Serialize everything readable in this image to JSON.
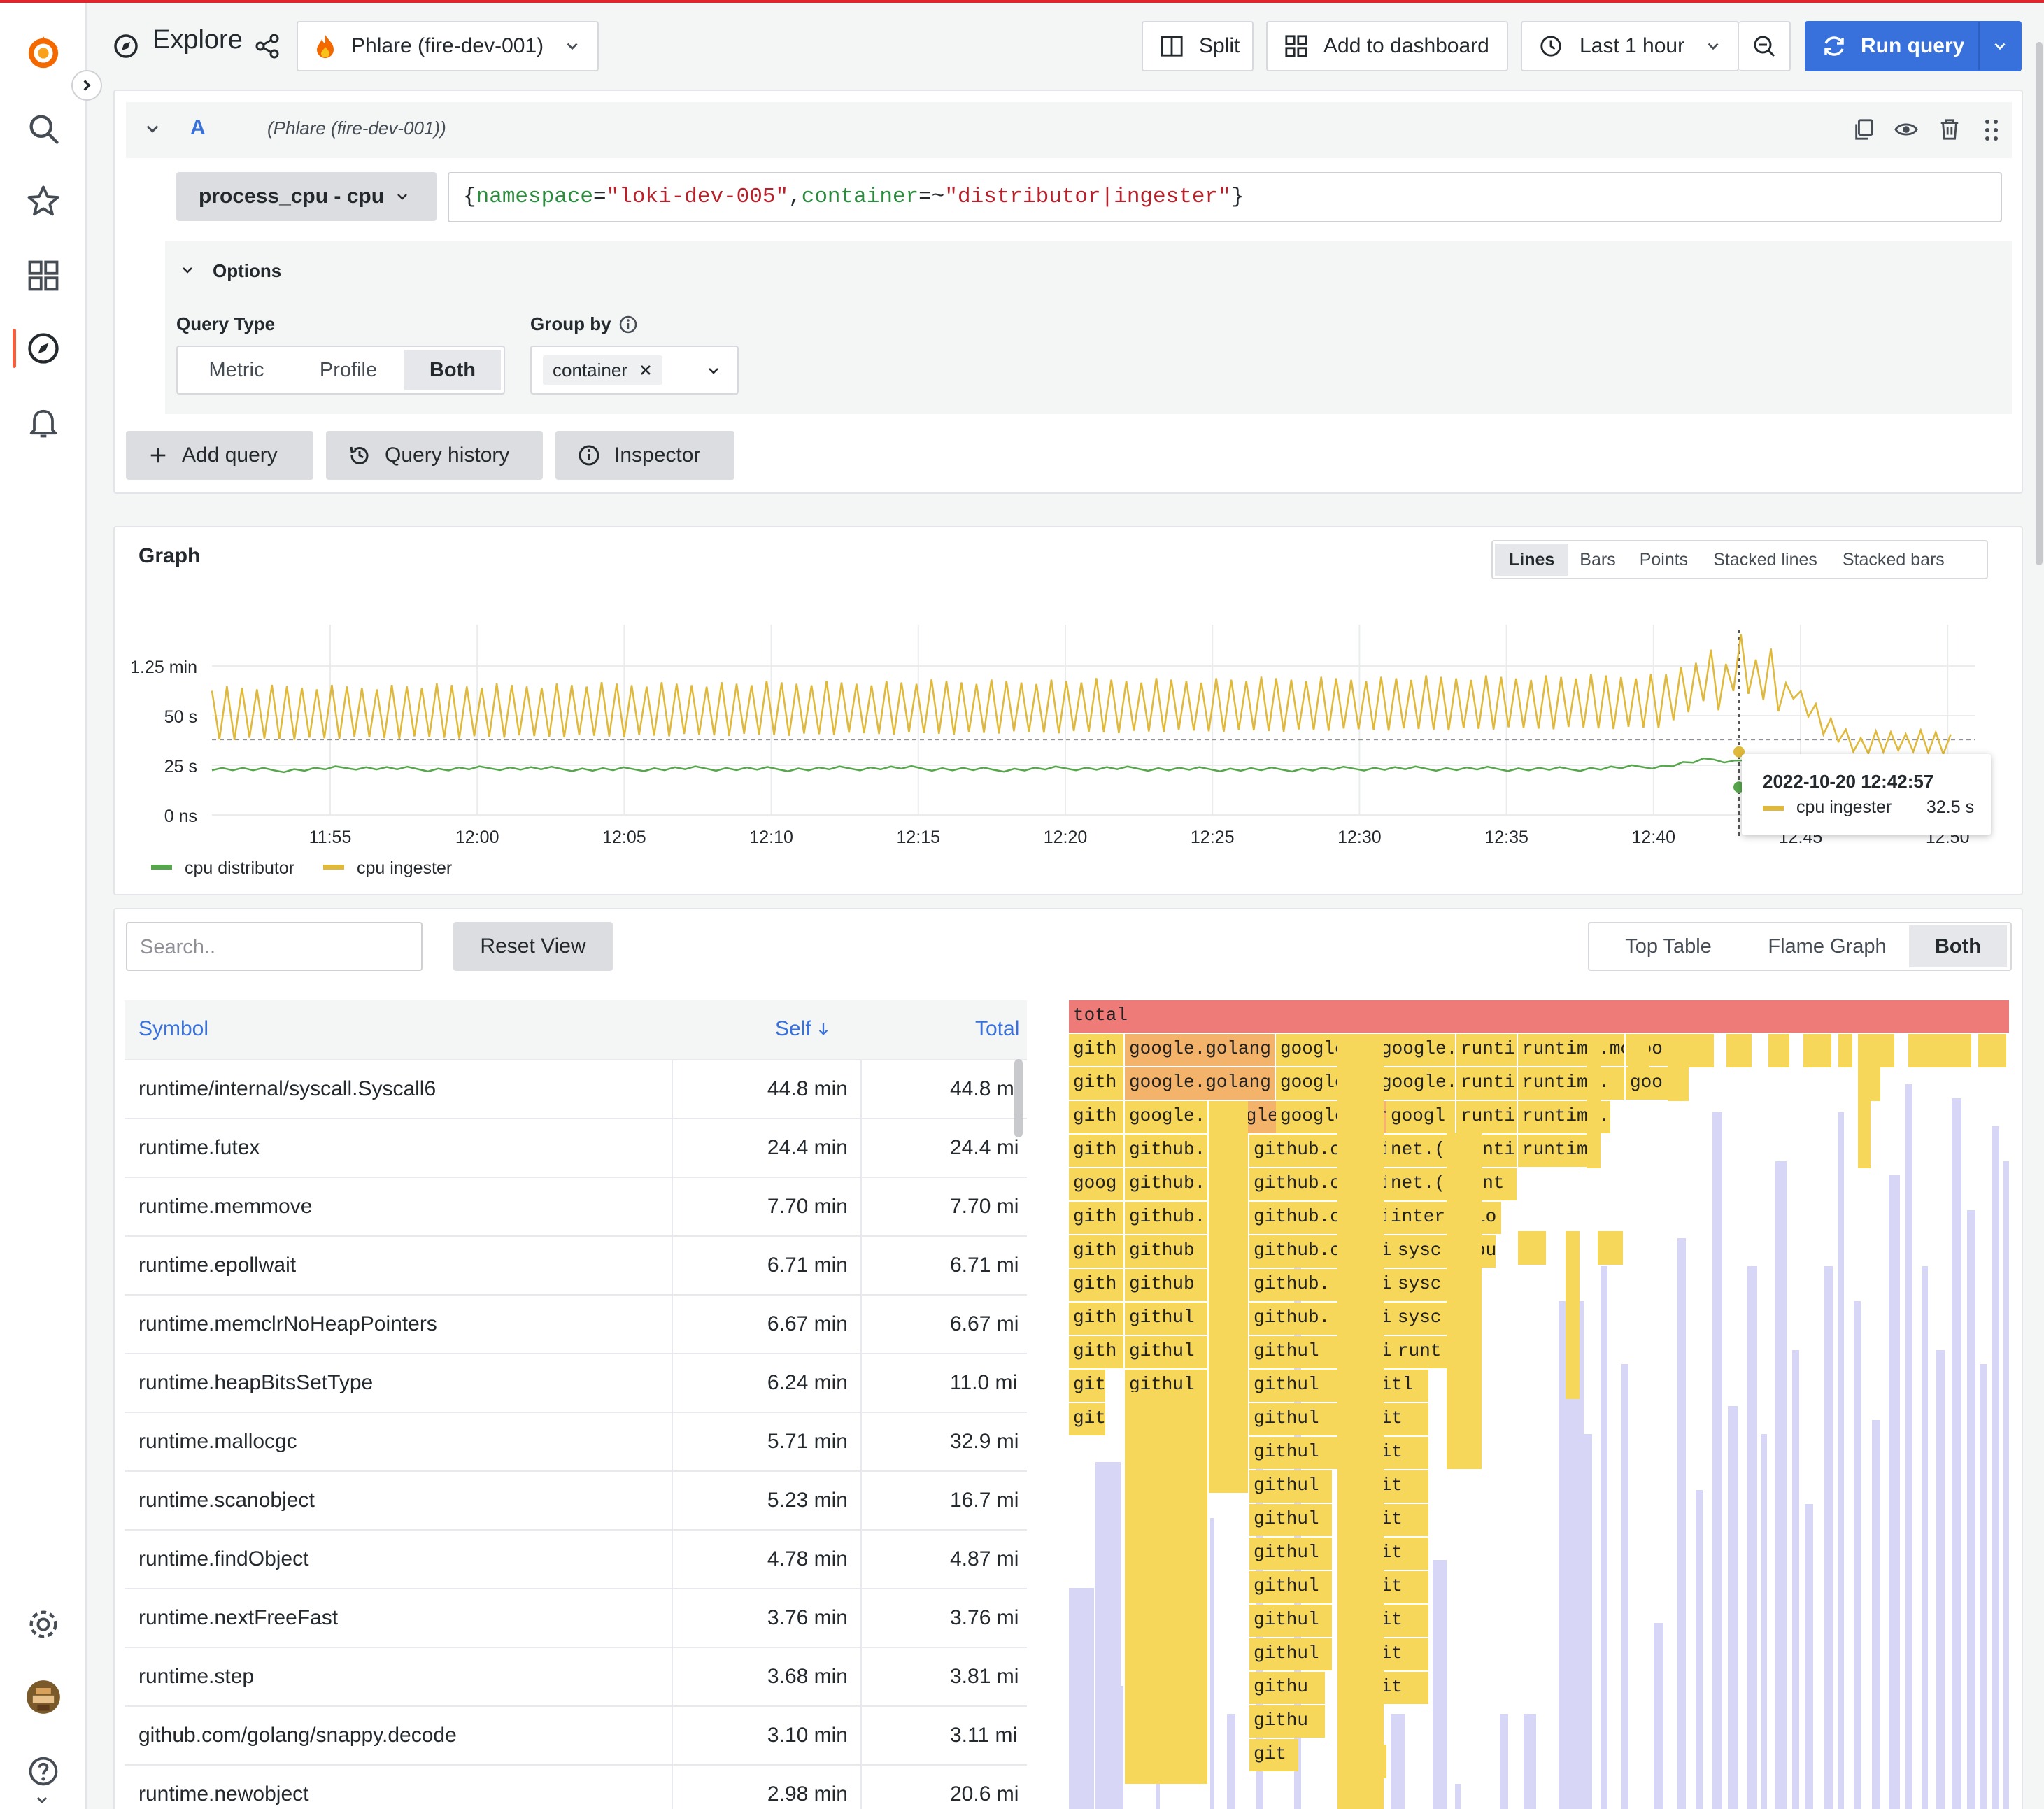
{
  "header": {
    "title": "Explore",
    "datasource": "Phlare (fire-dev-001)",
    "split_label": "Split",
    "add_to_dashboard_label": "Add to dashboard",
    "time_range": "Last 1 hour",
    "run_query_label": "Run query"
  },
  "query": {
    "ref_id": "A",
    "datasource_label": "(Phlare (fire-dev-001))",
    "profile_type": "process_cpu - cpu",
    "selector": {
      "open": "{",
      "key1": "namespace",
      "op1": "=",
      "val1": "\"loki-dev-005\"",
      "comma": ",",
      "key2": "container",
      "op2": "=~",
      "val2": "\"distributor|ingester\"",
      "close": "}"
    },
    "options_label": "Options",
    "query_type_label": "Query Type",
    "query_types": [
      "Metric",
      "Profile",
      "Both"
    ],
    "query_type_selected": "Both",
    "group_by_label": "Group by",
    "group_by_value": "container",
    "add_query_label": "Add query",
    "history_label": "Query history",
    "inspector_label": "Inspector"
  },
  "graph": {
    "title": "Graph",
    "styles": [
      "Lines",
      "Bars",
      "Points",
      "Stacked lines",
      "Stacked bars"
    ],
    "style_selected": "Lines"
  },
  "chart_data": {
    "type": "line",
    "x_ticks": [
      "11:55",
      "12:00",
      "12:05",
      "12:10",
      "12:15",
      "12:20",
      "12:25",
      "12:30",
      "12:35",
      "12:40",
      "12:45",
      "12:50"
    ],
    "y_ticks": [
      "1.25 min",
      "50 s",
      "25 s",
      "0 ns"
    ],
    "y_tick_values_s": [
      75,
      50,
      25,
      0
    ],
    "ylim_s": [
      0,
      92
    ],
    "x_start_min": 11.6,
    "x_end_min": 71.6,
    "threshold_s": 38,
    "grid": true,
    "legend_position": "bottom-left",
    "series": [
      {
        "name": "cpu distributor",
        "color": "#56a64b",
        "x_min": [
          11.6,
          13.8,
          16.5,
          19.1,
          21.5,
          25.0,
          28.0,
          31.2,
          34.8,
          38.1,
          41.0,
          44.5,
          47.9,
          51.0,
          54.5,
          57.8,
          61.0,
          62.6,
          63.4,
          64.0,
          64.5,
          65.0,
          65.8,
          67.0,
          68.0,
          69.3,
          70.1
        ],
        "values_s": [
          23.5,
          22.4,
          23.8,
          22.9,
          23.6,
          22.8,
          23.4,
          23.0,
          23.7,
          22.7,
          23.5,
          23.1,
          22.8,
          23.4,
          23.2,
          23.0,
          24.5,
          28.0,
          27.0,
          29.0,
          27.5,
          19.5,
          20.2,
          19.4,
          19.9,
          16.6,
          14.2
        ]
      },
      {
        "name": "cpu ingester",
        "color": "#e0b93a",
        "x_min": [
          11.6,
          61.0,
          62.6,
          63.0,
          63.6,
          64.1,
          64.6,
          65.0,
          65.4,
          66.4,
          67.6,
          68.4,
          70.8
        ],
        "values_s": [
          50.0,
          56.0,
          70.0,
          60.0,
          80.0,
          64.0,
          72.0,
          60.0,
          62.0,
          45.0,
          34.0,
          36.0,
          35.0
        ]
      }
    ],
    "tooltip": {
      "time": "2022-10-20 12:42:57",
      "series": "cpu ingester",
      "value": "32.5 s",
      "x_min": 68.4,
      "value_s": 32.5
    }
  },
  "profile": {
    "search_placeholder": "Search..",
    "reset_label": "Reset View",
    "view_modes": [
      "Top Table",
      "Flame Graph",
      "Both"
    ],
    "view_selected": "Both",
    "table": {
      "headers": [
        "Symbol",
        "Self",
        "Total"
      ],
      "rows": [
        {
          "symbol": "runtime/internal/syscall.Syscall6",
          "self": "44.8 min",
          "total": "44.8 mi"
        },
        {
          "symbol": "runtime.futex",
          "self": "24.4 min",
          "total": "24.4 mi"
        },
        {
          "symbol": "runtime.memmove",
          "self": "7.70 min",
          "total": "7.70 mi"
        },
        {
          "symbol": "runtime.epollwait",
          "self": "6.71 min",
          "total": "6.71 mi"
        },
        {
          "symbol": "runtime.memclrNoHeapPointers",
          "self": "6.67 min",
          "total": "6.67 mi"
        },
        {
          "symbol": "runtime.heapBitsSetType",
          "self": "6.24 min",
          "total": "11.0 mi"
        },
        {
          "symbol": "runtime.mallocgc",
          "self": "5.71 min",
          "total": "32.9 mi"
        },
        {
          "symbol": "runtime.scanobject",
          "self": "5.23 min",
          "total": "16.7 mi"
        },
        {
          "symbol": "runtime.findObject",
          "self": "4.78 min",
          "total": "4.87 mi"
        },
        {
          "symbol": "runtime.nextFreeFast",
          "self": "3.76 min",
          "total": "3.76 mi"
        },
        {
          "symbol": "runtime.step",
          "self": "3.68 min",
          "total": "3.81 mi"
        },
        {
          "symbol": "github.com/golang/snappy.decode",
          "self": "3.10 min",
          "total": "3.11 mi"
        },
        {
          "symbol": "runtime.newobject",
          "self": "2.98 min",
          "total": "20.6 mi"
        }
      ]
    },
    "flame": {
      "root": "total",
      "rows": [
        [
          "gith",
          "google.golang.org/grpc.(*Ser",
          "google.go",
          "google.",
          "runti",
          "runtime.mc",
          "goo"
        ],
        [
          "gith",
          "google.golang.org/grpc.(*Ser",
          "google.go",
          "google.",
          "runti",
          "runtime.",
          "goo"
        ],
        [
          "gith",
          "google.",
          "google.golang.org/grp",
          "google.go",
          "googl",
          "runti",
          "runtime."
        ],
        [
          "gith",
          "github.",
          "git",
          "github.com",
          "githu",
          "golan",
          "net.(",
          "runti",
          "runtim"
        ],
        [
          "goog",
          "github.",
          "git",
          "github.c",
          "gith",
          "gol",
          "net.(",
          "runt"
        ],
        [
          "gith",
          "github.",
          "git",
          "github.c",
          "gith",
          "io",
          "inter"
        ],
        [
          "gith",
          "github",
          "git",
          "github.c",
          "gith",
          "bu",
          "sysc"
        ],
        [
          "gith",
          "github",
          "github.",
          "gith",
          "sysc"
        ],
        [
          "gith",
          "githul",
          "github.",
          "gith",
          "sysc"
        ],
        [
          "gith",
          "githul",
          "githul",
          "gitl",
          "runt"
        ],
        [
          "git",
          "githul",
          "githul",
          "gitl"
        ],
        [
          "git",
          "githul",
          "githul",
          "git"
        ],
        [
          "githul",
          "githul",
          "git"
        ],
        [
          "githu",
          "githul",
          "git"
        ],
        [
          "githu",
          "githul",
          "git"
        ],
        [
          "githu",
          "githul",
          "git"
        ],
        [
          "githu",
          "githul",
          "git"
        ],
        [
          "githul",
          "git"
        ],
        [
          "githul",
          "git"
        ],
        [
          "githu",
          "git"
        ],
        [
          "githu"
        ],
        [
          "git"
        ]
      ]
    }
  },
  "colors": {
    "accent": "#3871dc",
    "distributor": "#56a64b",
    "ingester": "#e0b93a",
    "flame_root": "#ef7b78",
    "flame_match": "#f7d75a",
    "flame_highlight": "#f4b36b",
    "flame_dim": "#d8d6f6"
  }
}
